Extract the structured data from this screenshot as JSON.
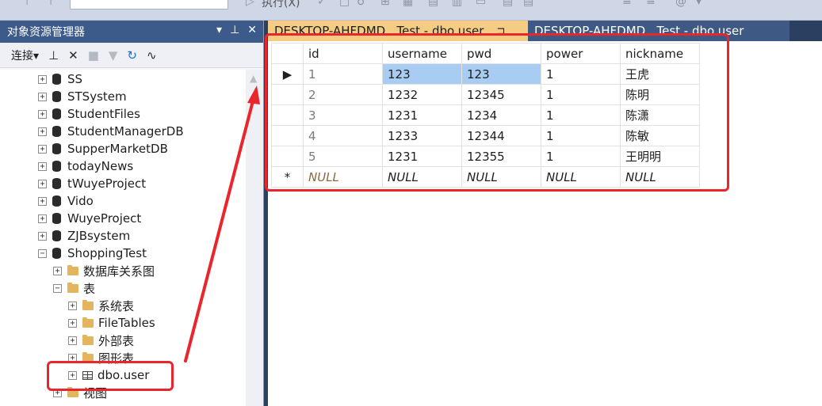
{
  "toolbar": {
    "execute_label": "执行(X)"
  },
  "explorer": {
    "title": "对象资源管理器",
    "title_buttons": [
      "▾",
      "📌",
      "✕"
    ],
    "connect_label": "连接",
    "tree": [
      {
        "label": "SS",
        "type": "db",
        "level": 0,
        "expander": "+"
      },
      {
        "label": "STSystem",
        "type": "db",
        "level": 0,
        "expander": "+"
      },
      {
        "label": "StudentFiles",
        "type": "db",
        "level": 0,
        "expander": "+"
      },
      {
        "label": "StudentManagerDB",
        "type": "db",
        "level": 0,
        "expander": "+"
      },
      {
        "label": "SupperMarketDB",
        "type": "db",
        "level": 0,
        "expander": "+"
      },
      {
        "label": "todayNews",
        "type": "db",
        "level": 0,
        "expander": "+"
      },
      {
        "label": "tWuyeProject",
        "type": "db",
        "level": 0,
        "expander": "+"
      },
      {
        "label": "Vido",
        "type": "db",
        "level": 0,
        "expander": "+"
      },
      {
        "label": "WuyeProject",
        "type": "db",
        "level": 0,
        "expander": "+"
      },
      {
        "label": "ZJBsystem",
        "type": "db",
        "level": 0,
        "expander": "+"
      },
      {
        "label": "ShoppingTest",
        "type": "db",
        "level": 0,
        "expander": "−"
      },
      {
        "label": "数据库关系图",
        "type": "folder",
        "level": 1,
        "expander": "+"
      },
      {
        "label": "表",
        "type": "folder",
        "level": 1,
        "expander": "−"
      },
      {
        "label": "系统表",
        "type": "folder",
        "level": 2,
        "expander": "+"
      },
      {
        "label": "FileTables",
        "type": "folder",
        "level": 2,
        "expander": "+"
      },
      {
        "label": "外部表",
        "type": "folder",
        "level": 2,
        "expander": "+"
      },
      {
        "label": "图形表",
        "type": "folder",
        "level": 2,
        "expander": "+"
      },
      {
        "label": "dbo.user",
        "type": "table",
        "level": 2,
        "expander": "+"
      },
      {
        "label": "视图",
        "type": "folder",
        "level": 1,
        "expander": "+"
      }
    ]
  },
  "tabs": [
    {
      "label": "DESKTOP-AHFDMD...Test - dbo.user",
      "active": true,
      "pin": "⊐"
    },
    {
      "label": "DESKTOP-AHFDMD...Test - dbo.user",
      "active": false
    }
  ],
  "grid": {
    "columns": [
      "id",
      "username",
      "pwd",
      "power",
      "nickname"
    ],
    "rows": [
      {
        "marker": "▶",
        "cells": [
          "1",
          "123",
          "123",
          "1",
          "王虎"
        ]
      },
      {
        "marker": "",
        "cells": [
          "2",
          "1232",
          "12345",
          "1",
          "陈明"
        ]
      },
      {
        "marker": "",
        "cells": [
          "3",
          "1231",
          "1234",
          "1",
          "陈潇"
        ]
      },
      {
        "marker": "",
        "cells": [
          "4",
          "1233",
          "12344",
          "1",
          "陈敏"
        ]
      },
      {
        "marker": "",
        "cells": [
          "5",
          "1231",
          "12355",
          "1",
          "王明明"
        ]
      },
      {
        "marker": "*",
        "cells": [
          "NULL",
          "NULL",
          "NULL",
          "NULL",
          "NULL"
        ]
      }
    ]
  },
  "colors": {
    "annotation": "#e8262c",
    "active_tab": "#f5cc84",
    "selection": "#a9cdf2"
  }
}
